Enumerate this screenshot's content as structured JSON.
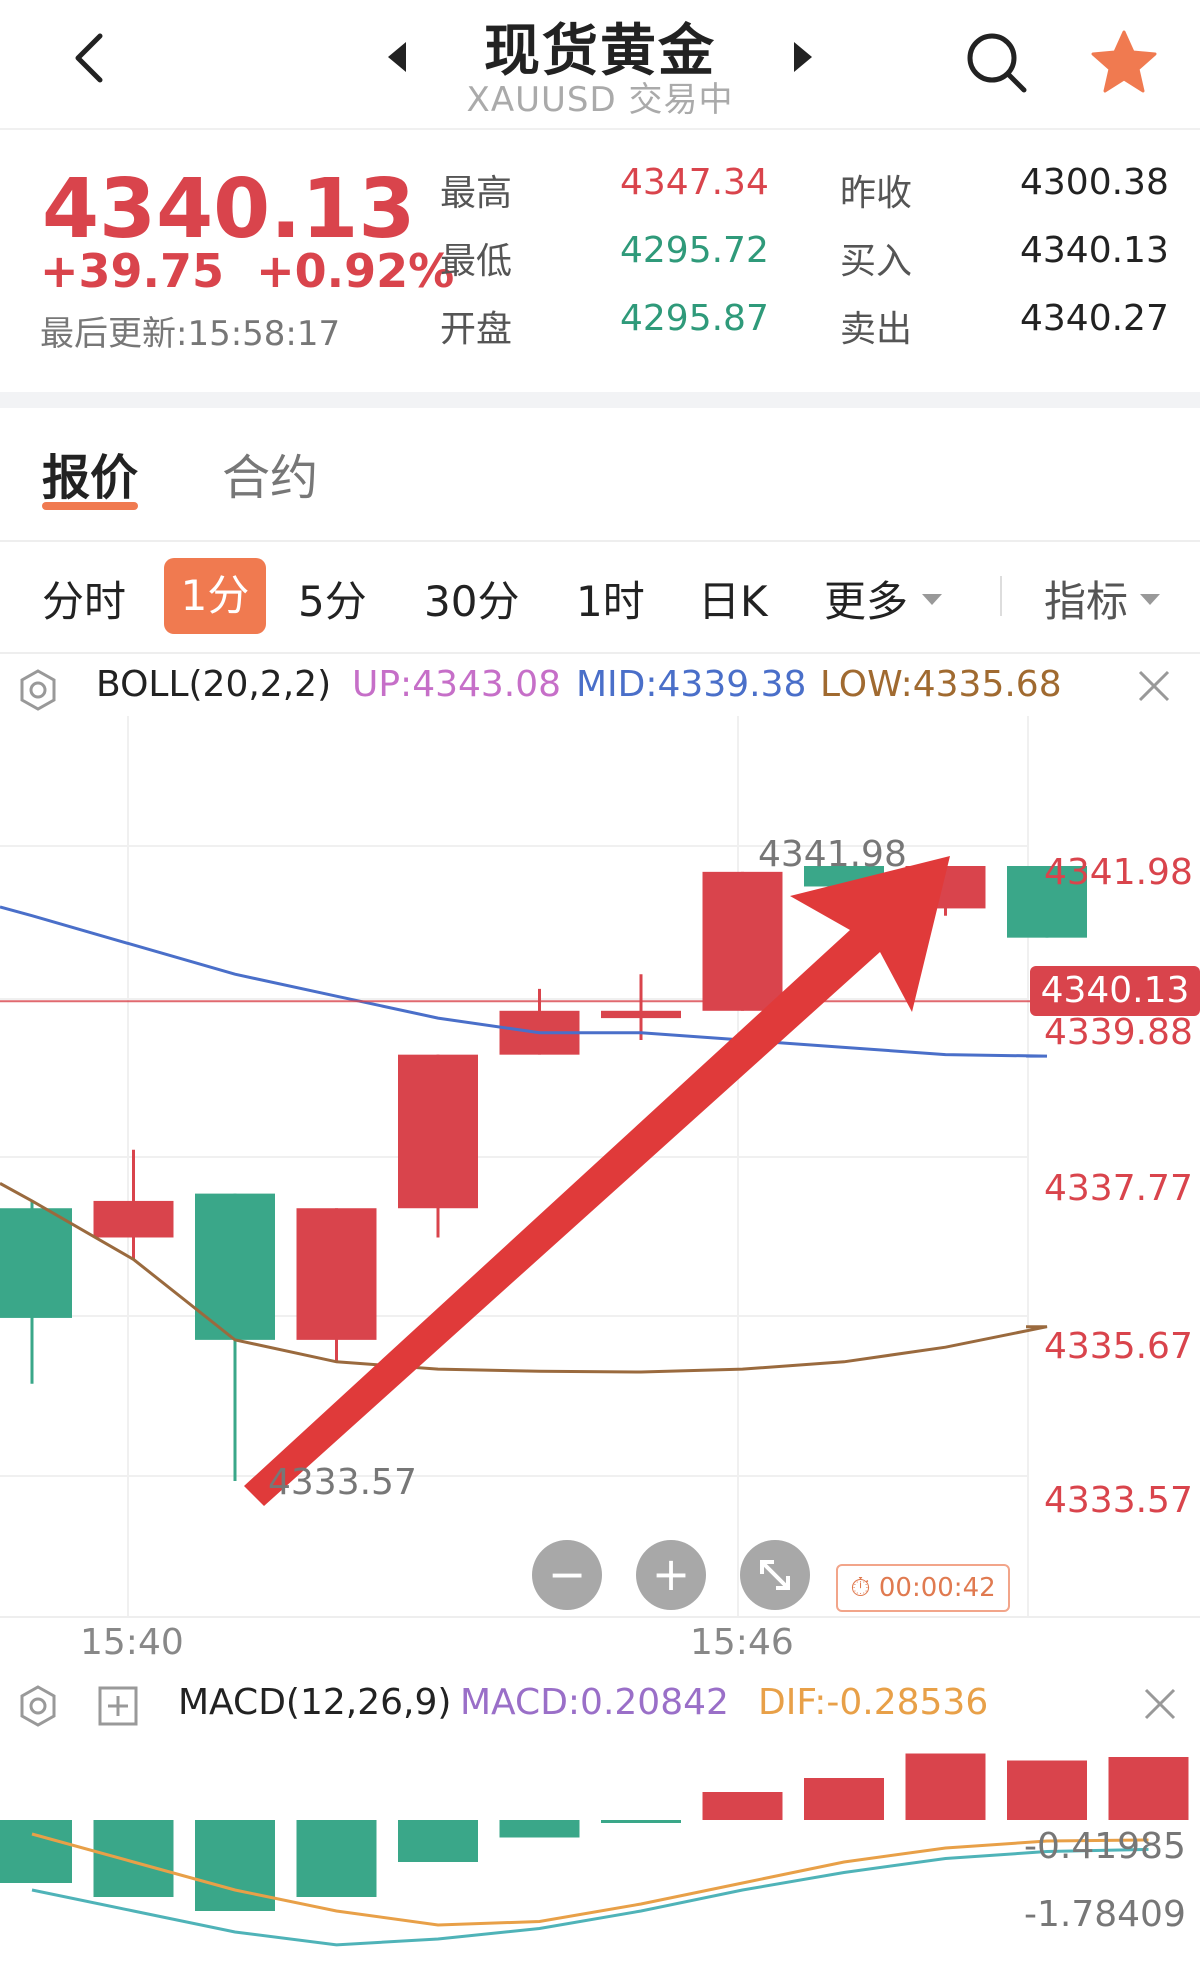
{
  "header": {
    "title": "现货黄金",
    "subtitle": "XAUUSD 交易中"
  },
  "quote": {
    "price": "4340.13",
    "change": "+39.75  +0.92%",
    "updated": "最后更新:15:58:17",
    "stats": [
      {
        "label": "最高",
        "value": "4347.34",
        "color": "red"
      },
      {
        "label": "最低",
        "value": "4295.72",
        "color": "green"
      },
      {
        "label": "开盘",
        "value": "4295.87",
        "color": "green"
      },
      {
        "label": "昨收",
        "value": "4300.38",
        "color": "dark"
      },
      {
        "label": "买入",
        "value": "4340.13",
        "color": "dark"
      },
      {
        "label": "卖出",
        "value": "4340.27",
        "color": "dark"
      }
    ]
  },
  "tabs": [
    "报价",
    "合约"
  ],
  "periods": [
    "分时",
    "1分",
    "5分",
    "30分",
    "1时",
    "日K",
    "更多",
    "指标"
  ],
  "boll": {
    "name": "BOLL(20,2,2)",
    "up": "UP:4343.08",
    "mid": "MID:4339.38",
    "low": "LOW:4335.68"
  },
  "price_axis": [
    "4341.98",
    "4339.88",
    "4337.77",
    "4335.67",
    "4333.57"
  ],
  "current_price_tag": "4340.13",
  "annotations": {
    "high": "4341.98",
    "low": "4333.57"
  },
  "timer": "00:00:42",
  "x_labels": [
    "15:40",
    "15:46"
  ],
  "macd": {
    "name": "MACD(12,26,9)",
    "macd": "MACD:0.20842",
    "dif": "DIF:-0.28536",
    "axis": [
      "-0.41985",
      "-1.78409"
    ]
  },
  "colors": {
    "up": "#d9444c",
    "down": "#3aa789",
    "upper_band": "#4a6fc9",
    "lower_band": "#9a6a3e",
    "accent": "#f07a50"
  },
  "chart_data": {
    "type": "candlestick",
    "candles": [
      {
        "open": 4337.3,
        "close": 4335.8,
        "high": 4337.4,
        "low": 4334.9
      },
      {
        "open": 4336.9,
        "close": 4337.4,
        "high": 4338.1,
        "low": 4336.6
      },
      {
        "open": 4337.5,
        "close": 4335.5,
        "high": 4337.5,
        "low": 4333.57
      },
      {
        "open": 4335.5,
        "close": 4337.3,
        "high": 4337.3,
        "low": 4335.2
      },
      {
        "open": 4337.3,
        "close": 4339.4,
        "high": 4339.4,
        "low": 4336.9
      },
      {
        "open": 4339.4,
        "close": 4340.0,
        "high": 4340.3,
        "low": 4339.4
      },
      {
        "open": 4339.9,
        "close": 4340.0,
        "high": 4340.5,
        "low": 4339.6
      },
      {
        "open": 4340.0,
        "close": 4341.9,
        "high": 4341.9,
        "low": 4340.0
      },
      {
        "open": 4341.98,
        "close": 4341.7,
        "high": 4341.98,
        "low": 4341.7
      },
      {
        "open": 4341.4,
        "close": 4341.98,
        "high": 4341.98,
        "low": 4341.3
      },
      {
        "open": 4341.98,
        "close": 4341.0,
        "high": 4341.98,
        "low": 4341.0
      }
    ],
    "boll_mid": [
      4341.3,
      4340.9,
      4340.5,
      4340.2,
      4339.9,
      4339.7,
      4339.7,
      4339.6,
      4339.5,
      4339.4,
      4339.38
    ],
    "boll_low": [
      4337.4,
      4336.6,
      4335.5,
      4335.2,
      4335.1,
      4335.07,
      4335.06,
      4335.1,
      4335.2,
      4335.4,
      4335.68
    ],
    "ylim": [
      4333.57,
      4341.98
    ],
    "macd_hist": [
      -0.9,
      -1.1,
      -1.3,
      -1.1,
      -0.6,
      -0.25,
      -0.02,
      0.4,
      0.6,
      0.95,
      0.85,
      0.9
    ],
    "macd_dif": [
      -1.0,
      -1.3,
      -1.6,
      -1.78409,
      -1.7,
      -1.55,
      -1.3,
      -1.0,
      -0.75,
      -0.55,
      -0.45,
      -0.41985
    ],
    "macd_dea": [
      -0.2,
      -0.6,
      -1.0,
      -1.3,
      -1.5,
      -1.45,
      -1.2,
      -0.9,
      -0.6,
      -0.4,
      -0.3,
      -0.28536
    ]
  }
}
